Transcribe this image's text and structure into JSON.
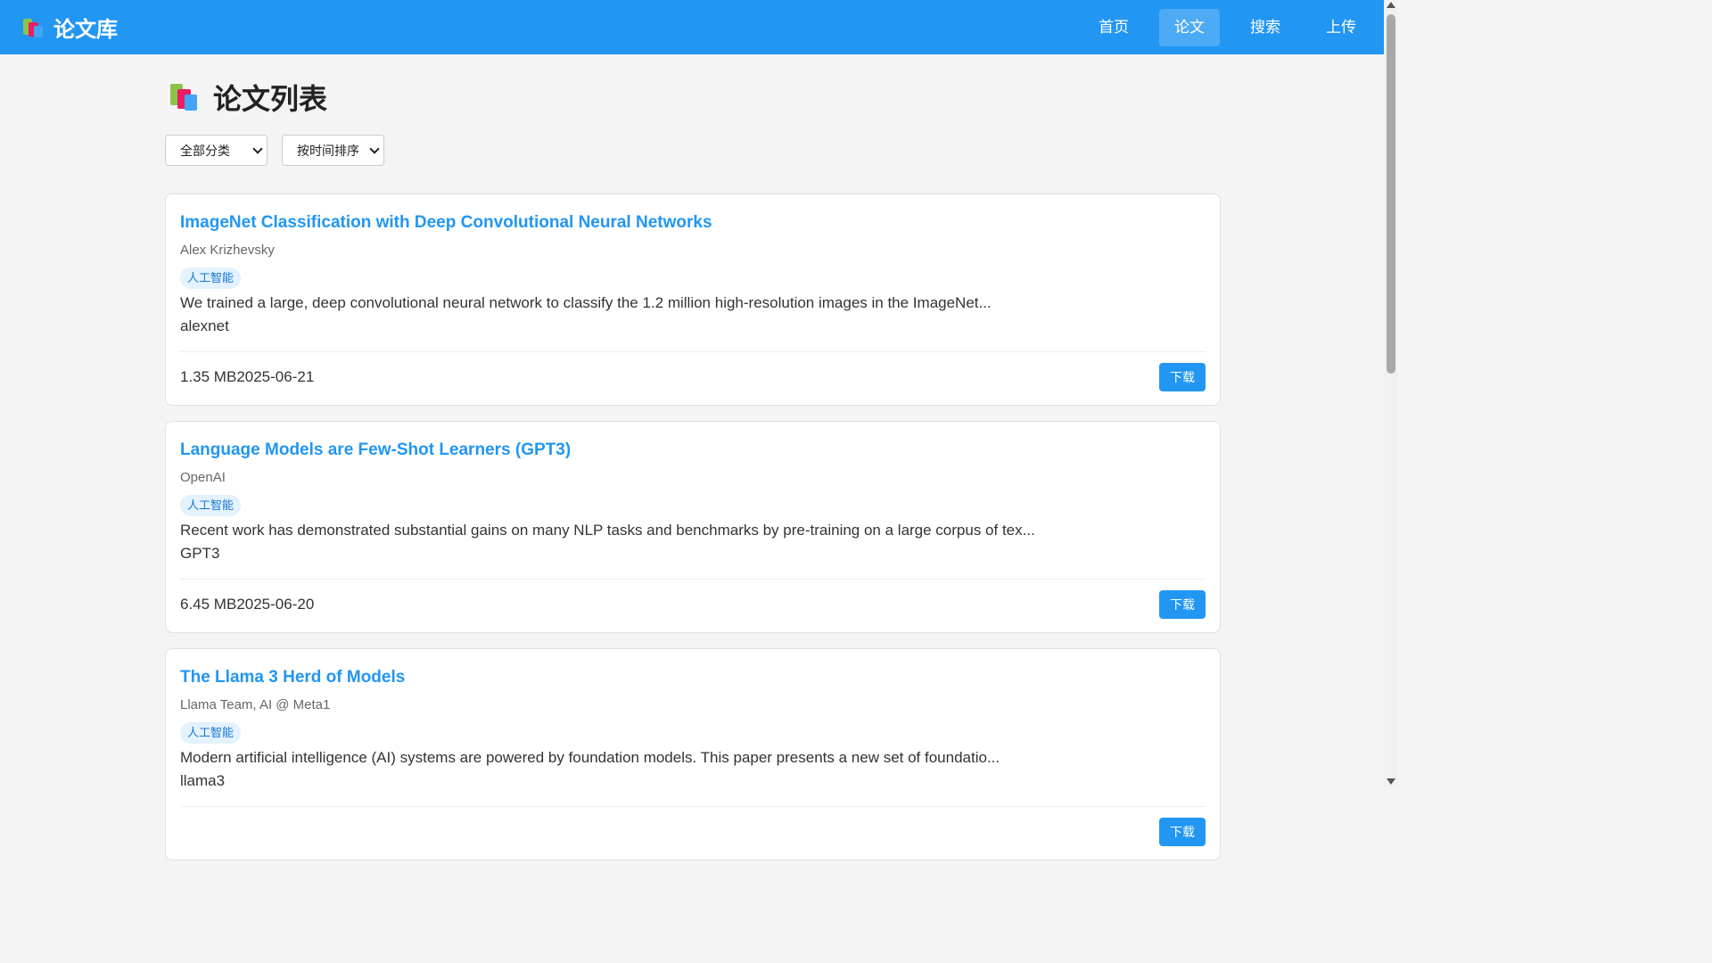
{
  "header": {
    "brand": "论文库",
    "nav": [
      {
        "label": "首页",
        "active": false
      },
      {
        "label": "论文",
        "active": true
      },
      {
        "label": "搜索",
        "active": false
      },
      {
        "label": "上传",
        "active": false
      }
    ]
  },
  "page": {
    "title": "论文列表",
    "category_filter": "全部分类",
    "sort_filter": "按时间排序"
  },
  "papers": [
    {
      "title": "ImageNet Classification with Deep Convolutional Neural Networks",
      "author": "Alex Krizhevsky",
      "tag": "人工智能",
      "description": "We trained a large, deep convolutional neural network to classify the 1.2 million high-resolution images in the ImageNet...",
      "keyword": "alexnet",
      "size": "1.35 MB",
      "date": "2025-06-21",
      "download_label": "下载"
    },
    {
      "title": "Language Models are Few-Shot Learners (GPT3)",
      "author": "OpenAI",
      "tag": "人工智能",
      "description": "Recent work has demonstrated substantial gains on many NLP tasks and benchmarks by pre-training on a large corpus of tex...",
      "keyword": "GPT3",
      "size": "6.45 MB",
      "date": "2025-06-20",
      "download_label": "下载"
    },
    {
      "title": "The Llama 3 Herd of Models",
      "author": "Llama Team, AI @ Meta1",
      "tag": "人工智能",
      "description": "Modern artificial intelligence (AI) systems are powered by foundation models. This paper presents a new set of foundatio...",
      "keyword": "llama3",
      "size": "",
      "date": "",
      "download_label": "下载"
    }
  ],
  "colors": {
    "primary": "#2196f3",
    "background": "#f4f4f4"
  }
}
